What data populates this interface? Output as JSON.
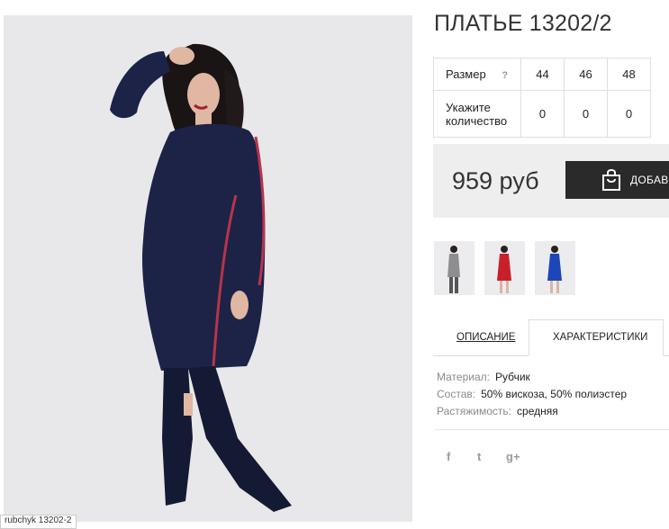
{
  "product": {
    "title": "ПЛАТЬЕ 13202/2",
    "photo_caption": "rubchyk 13202-2"
  },
  "sizes": {
    "header_label": "Размер",
    "help": "?",
    "values": [
      "44",
      "46",
      "48"
    ],
    "quantity_label_line1": "Укажите",
    "quantity_label_line2": "количество",
    "quantities": [
      "0",
      "0",
      "0"
    ]
  },
  "buy": {
    "price": "959 руб",
    "add_label": "ДОБАВИТЬ"
  },
  "thumbnails": [
    {
      "color_name": "gray",
      "color": "#8e8e92"
    },
    {
      "color_name": "red",
      "color": "#c8202a"
    },
    {
      "color_name": "blue",
      "color": "#1d46b8"
    }
  ],
  "tabs": {
    "description": "ОПИСАНИЕ",
    "characteristics": "ХАРАКТЕРИСТИКИ"
  },
  "specs": [
    {
      "key": "Материал:",
      "value": "Рубчик"
    },
    {
      "key": "Состав:",
      "value": "50% вискоза, 50% полиэстер"
    },
    {
      "key": "Растяжимость:",
      "value": "средняя"
    }
  ],
  "social": {
    "facebook": "f",
    "twitter": "t",
    "google": "g+"
  },
  "colors": {
    "dress": "#1c2347",
    "stripe": "#b8344a",
    "button_bg": "#2a2a2a",
    "panel_bg": "#eeeeee"
  }
}
